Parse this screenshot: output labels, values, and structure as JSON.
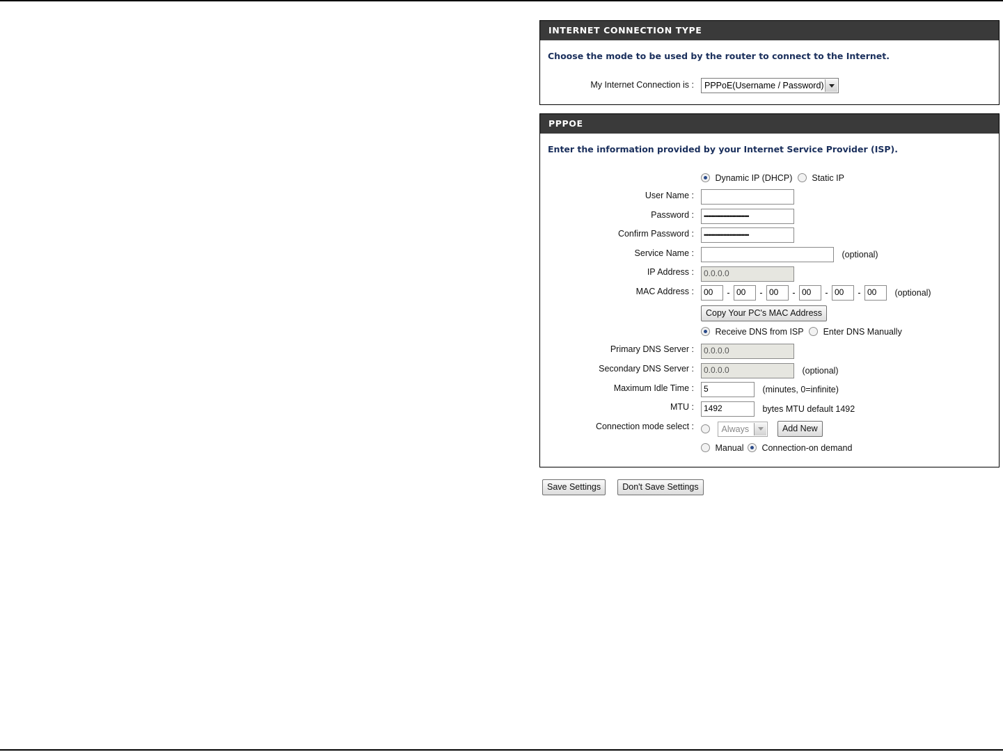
{
  "connection_type": {
    "header": "INTERNET CONNECTION TYPE",
    "intro": "Choose the mode to be used by the router to connect to the Internet.",
    "label": "My Internet Connection is :",
    "selected": "PPPoE(Username / Password)"
  },
  "pppoe": {
    "header": "PPPOE",
    "intro": "Enter the information provided by your Internet Service Provider (ISP).",
    "ip_mode": {
      "options": [
        "Dynamic IP (DHCP)",
        "Static IP"
      ],
      "selected": "Dynamic IP (DHCP)"
    },
    "user_name": {
      "label": "User Name :",
      "value": ""
    },
    "password": {
      "label": "Password :",
      "value": "••••••••••••••••••••••••••••••"
    },
    "confirm_password": {
      "label": "Confirm Password :",
      "value": "••••••••••••••••••••••••••••••"
    },
    "service_name": {
      "label": "Service Name :",
      "value": "",
      "hint": "(optional)"
    },
    "ip_address": {
      "label": "IP Address :",
      "value": "0.0.0.0"
    },
    "mac_address": {
      "label": "MAC Address :",
      "octets": [
        "00",
        "00",
        "00",
        "00",
        "00",
        "00"
      ],
      "separator": "-",
      "hint": "(optional)"
    },
    "copy_mac_button": "Copy Your PC's MAC Address",
    "dns_mode": {
      "options": [
        "Receive DNS from ISP",
        "Enter DNS Manually"
      ],
      "selected": "Receive DNS from ISP"
    },
    "primary_dns": {
      "label": "Primary DNS Server :",
      "value": "0.0.0.0"
    },
    "secondary_dns": {
      "label": "Secondary DNS Server :",
      "value": "0.0.0.0",
      "hint": "(optional)"
    },
    "max_idle_time": {
      "label": "Maximum Idle Time :",
      "value": "5",
      "hint": "(minutes, 0=infinite)"
    },
    "mtu": {
      "label": "MTU :",
      "value": "1492",
      "hint": "bytes MTU default 1492"
    },
    "connection_mode": {
      "label": "Connection mode select :",
      "schedule_selected": "Always",
      "add_new_button": "Add New",
      "options": [
        "Manual",
        "Connection-on demand"
      ],
      "selected": "Connection-on demand"
    }
  },
  "actions": {
    "save": "Save Settings",
    "dont_save": "Don't Save Settings"
  }
}
